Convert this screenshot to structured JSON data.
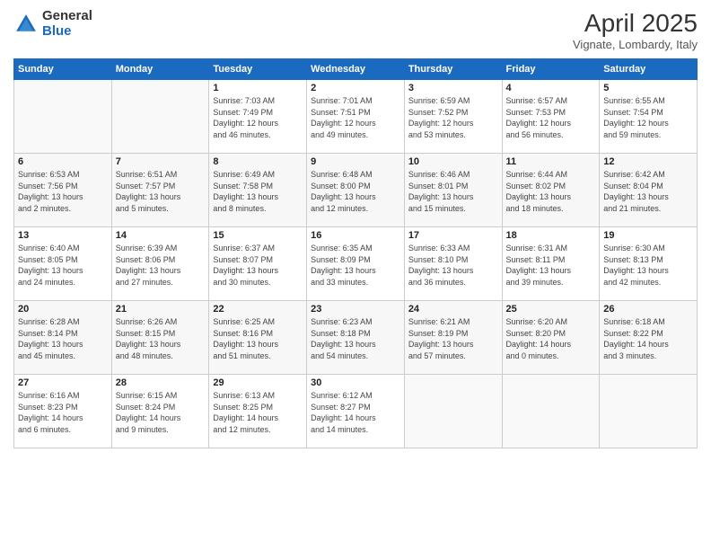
{
  "header": {
    "logo_general": "General",
    "logo_blue": "Blue",
    "month": "April 2025",
    "location": "Vignate, Lombardy, Italy"
  },
  "days_of_week": [
    "Sunday",
    "Monday",
    "Tuesday",
    "Wednesday",
    "Thursday",
    "Friday",
    "Saturday"
  ],
  "weeks": [
    [
      {
        "day": "",
        "info": ""
      },
      {
        "day": "",
        "info": ""
      },
      {
        "day": "1",
        "info": "Sunrise: 7:03 AM\nSunset: 7:49 PM\nDaylight: 12 hours\nand 46 minutes."
      },
      {
        "day": "2",
        "info": "Sunrise: 7:01 AM\nSunset: 7:51 PM\nDaylight: 12 hours\nand 49 minutes."
      },
      {
        "day": "3",
        "info": "Sunrise: 6:59 AM\nSunset: 7:52 PM\nDaylight: 12 hours\nand 53 minutes."
      },
      {
        "day": "4",
        "info": "Sunrise: 6:57 AM\nSunset: 7:53 PM\nDaylight: 12 hours\nand 56 minutes."
      },
      {
        "day": "5",
        "info": "Sunrise: 6:55 AM\nSunset: 7:54 PM\nDaylight: 12 hours\nand 59 minutes."
      }
    ],
    [
      {
        "day": "6",
        "info": "Sunrise: 6:53 AM\nSunset: 7:56 PM\nDaylight: 13 hours\nand 2 minutes."
      },
      {
        "day": "7",
        "info": "Sunrise: 6:51 AM\nSunset: 7:57 PM\nDaylight: 13 hours\nand 5 minutes."
      },
      {
        "day": "8",
        "info": "Sunrise: 6:49 AM\nSunset: 7:58 PM\nDaylight: 13 hours\nand 8 minutes."
      },
      {
        "day": "9",
        "info": "Sunrise: 6:48 AM\nSunset: 8:00 PM\nDaylight: 13 hours\nand 12 minutes."
      },
      {
        "day": "10",
        "info": "Sunrise: 6:46 AM\nSunset: 8:01 PM\nDaylight: 13 hours\nand 15 minutes."
      },
      {
        "day": "11",
        "info": "Sunrise: 6:44 AM\nSunset: 8:02 PM\nDaylight: 13 hours\nand 18 minutes."
      },
      {
        "day": "12",
        "info": "Sunrise: 6:42 AM\nSunset: 8:04 PM\nDaylight: 13 hours\nand 21 minutes."
      }
    ],
    [
      {
        "day": "13",
        "info": "Sunrise: 6:40 AM\nSunset: 8:05 PM\nDaylight: 13 hours\nand 24 minutes."
      },
      {
        "day": "14",
        "info": "Sunrise: 6:39 AM\nSunset: 8:06 PM\nDaylight: 13 hours\nand 27 minutes."
      },
      {
        "day": "15",
        "info": "Sunrise: 6:37 AM\nSunset: 8:07 PM\nDaylight: 13 hours\nand 30 minutes."
      },
      {
        "day": "16",
        "info": "Sunrise: 6:35 AM\nSunset: 8:09 PM\nDaylight: 13 hours\nand 33 minutes."
      },
      {
        "day": "17",
        "info": "Sunrise: 6:33 AM\nSunset: 8:10 PM\nDaylight: 13 hours\nand 36 minutes."
      },
      {
        "day": "18",
        "info": "Sunrise: 6:31 AM\nSunset: 8:11 PM\nDaylight: 13 hours\nand 39 minutes."
      },
      {
        "day": "19",
        "info": "Sunrise: 6:30 AM\nSunset: 8:13 PM\nDaylight: 13 hours\nand 42 minutes."
      }
    ],
    [
      {
        "day": "20",
        "info": "Sunrise: 6:28 AM\nSunset: 8:14 PM\nDaylight: 13 hours\nand 45 minutes."
      },
      {
        "day": "21",
        "info": "Sunrise: 6:26 AM\nSunset: 8:15 PM\nDaylight: 13 hours\nand 48 minutes."
      },
      {
        "day": "22",
        "info": "Sunrise: 6:25 AM\nSunset: 8:16 PM\nDaylight: 13 hours\nand 51 minutes."
      },
      {
        "day": "23",
        "info": "Sunrise: 6:23 AM\nSunset: 8:18 PM\nDaylight: 13 hours\nand 54 minutes."
      },
      {
        "day": "24",
        "info": "Sunrise: 6:21 AM\nSunset: 8:19 PM\nDaylight: 13 hours\nand 57 minutes."
      },
      {
        "day": "25",
        "info": "Sunrise: 6:20 AM\nSunset: 8:20 PM\nDaylight: 14 hours\nand 0 minutes."
      },
      {
        "day": "26",
        "info": "Sunrise: 6:18 AM\nSunset: 8:22 PM\nDaylight: 14 hours\nand 3 minutes."
      }
    ],
    [
      {
        "day": "27",
        "info": "Sunrise: 6:16 AM\nSunset: 8:23 PM\nDaylight: 14 hours\nand 6 minutes."
      },
      {
        "day": "28",
        "info": "Sunrise: 6:15 AM\nSunset: 8:24 PM\nDaylight: 14 hours\nand 9 minutes."
      },
      {
        "day": "29",
        "info": "Sunrise: 6:13 AM\nSunset: 8:25 PM\nDaylight: 14 hours\nand 12 minutes."
      },
      {
        "day": "30",
        "info": "Sunrise: 6:12 AM\nSunset: 8:27 PM\nDaylight: 14 hours\nand 14 minutes."
      },
      {
        "day": "",
        "info": ""
      },
      {
        "day": "",
        "info": ""
      },
      {
        "day": "",
        "info": ""
      }
    ]
  ]
}
